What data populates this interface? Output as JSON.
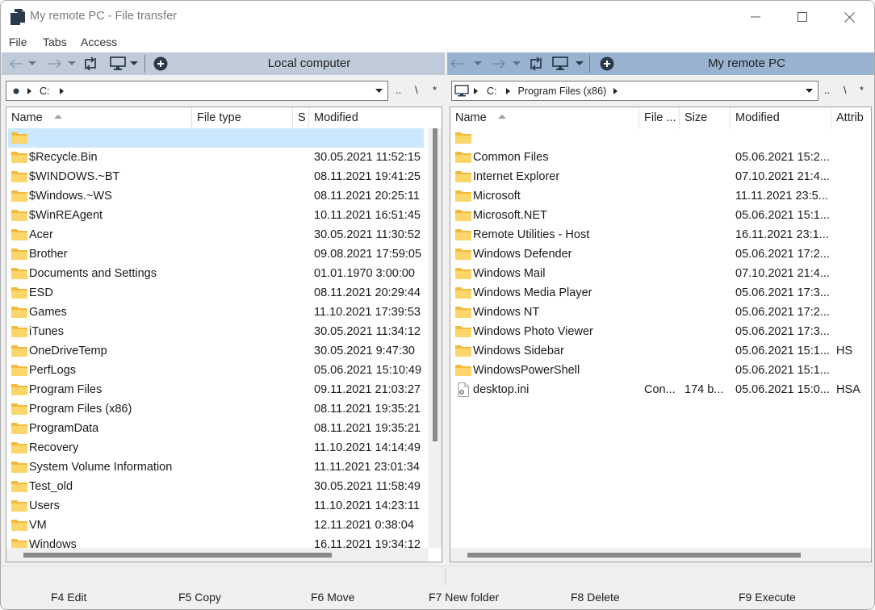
{
  "window": {
    "title": "My remote PC - File transfer",
    "controls": {
      "minimize": "minimize-icon",
      "maximize": "maximize-icon",
      "close": "close-icon"
    }
  },
  "menu": [
    "File",
    "Tabs",
    "Access"
  ],
  "left_panel": {
    "title": "Local computer",
    "toolbar_icons": [
      "back-arrow-icon",
      "chevron-down-icon",
      "forward-arrow-icon",
      "chevron-down-icon",
      "refresh-icon",
      "monitor-icon",
      "chevron-down-icon",
      "add-circle-icon"
    ],
    "address": {
      "root_icon": "dot-icon",
      "segments": [
        "C:"
      ]
    },
    "address_extras": [
      "..",
      "\\",
      "*"
    ],
    "columns": [
      "Name",
      "File type",
      "S",
      "Modified"
    ],
    "sort_column": "Name",
    "rows": [
      {
        "name": "",
        "type": "folder",
        "modified": "",
        "selected": true
      },
      {
        "name": "$Recycle.Bin",
        "type": "folder",
        "modified": "30.05.2021 11:52:15"
      },
      {
        "name": "$WINDOWS.~BT",
        "type": "folder",
        "modified": "08.11.2021 19:41:25"
      },
      {
        "name": "$Windows.~WS",
        "type": "folder",
        "modified": "08.11.2021 20:25:11"
      },
      {
        "name": "$WinREAgent",
        "type": "folder",
        "modified": "10.11.2021 16:51:45"
      },
      {
        "name": "Acer",
        "type": "folder",
        "modified": "30.05.2021 11:30:52"
      },
      {
        "name": "Brother",
        "type": "folder",
        "modified": "09.08.2021 17:59:05"
      },
      {
        "name": "Documents and Settings",
        "type": "folder",
        "modified": "01.01.1970 3:00:00"
      },
      {
        "name": "ESD",
        "type": "folder",
        "modified": "08.11.2021 20:29:44"
      },
      {
        "name": "Games",
        "type": "folder",
        "modified": "11.10.2021 17:39:53"
      },
      {
        "name": "iTunes",
        "type": "folder",
        "modified": "30.05.2021 11:34:12"
      },
      {
        "name": "OneDriveTemp",
        "type": "folder",
        "modified": "30.05.2021 9:47:30"
      },
      {
        "name": "PerfLogs",
        "type": "folder",
        "modified": "05.06.2021 15:10:49"
      },
      {
        "name": "Program Files",
        "type": "folder",
        "modified": "09.11.2021 21:03:27"
      },
      {
        "name": "Program Files (x86)",
        "type": "folder",
        "modified": "08.11.2021 19:35:21"
      },
      {
        "name": "ProgramData",
        "type": "folder",
        "modified": "08.11.2021 19:35:21"
      },
      {
        "name": "Recovery",
        "type": "folder",
        "modified": "11.10.2021 14:14:49"
      },
      {
        "name": "System Volume Information",
        "type": "folder",
        "modified": "11.11.2021 23:01:34"
      },
      {
        "name": "Test_old",
        "type": "folder",
        "modified": "30.05.2021 11:58:49"
      },
      {
        "name": "Users",
        "type": "folder",
        "modified": "11.10.2021 14:23:11"
      },
      {
        "name": "VM",
        "type": "folder",
        "modified": "12.11.2021 0:38:04"
      },
      {
        "name": "Windows",
        "type": "folder",
        "modified": "16.11.2021 19:34:12"
      }
    ],
    "vscroll_position": 0.0,
    "hscroll_position": 0.0
  },
  "right_panel": {
    "title": "My remote PC",
    "toolbar_icons": [
      "back-arrow-icon",
      "chevron-down-icon",
      "forward-arrow-icon",
      "chevron-down-icon",
      "refresh-icon",
      "monitor-icon",
      "chevron-down-icon",
      "add-circle-icon"
    ],
    "address": {
      "root_icon": "computer-icon",
      "segments": [
        "C:",
        "Program Files (x86)"
      ]
    },
    "address_extras": [
      "..",
      "\\",
      "*"
    ],
    "columns": [
      "Name",
      "File ...",
      "Size",
      "Modified",
      "Attrib"
    ],
    "sort_column": "Name",
    "rows": [
      {
        "name": "",
        "type": "folder",
        "filetype": "",
        "size": "",
        "modified": "",
        "attrib": ""
      },
      {
        "name": "Common Files",
        "type": "folder",
        "filetype": "",
        "size": "",
        "modified": "05.06.2021 15:2...",
        "attrib": ""
      },
      {
        "name": "Internet Explorer",
        "type": "folder",
        "filetype": "",
        "size": "",
        "modified": "07.10.2021 21:4...",
        "attrib": ""
      },
      {
        "name": "Microsoft",
        "type": "folder",
        "filetype": "",
        "size": "",
        "modified": "11.11.2021 23:5...",
        "attrib": ""
      },
      {
        "name": "Microsoft.NET",
        "type": "folder",
        "filetype": "",
        "size": "",
        "modified": "05.06.2021 15:1...",
        "attrib": ""
      },
      {
        "name": "Remote Utilities - Host",
        "type": "folder",
        "filetype": "",
        "size": "",
        "modified": "16.11.2021 23:1...",
        "attrib": ""
      },
      {
        "name": "Windows Defender",
        "type": "folder",
        "filetype": "",
        "size": "",
        "modified": "05.06.2021 17:2...",
        "attrib": ""
      },
      {
        "name": "Windows Mail",
        "type": "folder",
        "filetype": "",
        "size": "",
        "modified": "07.10.2021 21:4...",
        "attrib": ""
      },
      {
        "name": "Windows Media Player",
        "type": "folder",
        "filetype": "",
        "size": "",
        "modified": "05.06.2021 17:3...",
        "attrib": ""
      },
      {
        "name": "Windows NT",
        "type": "folder",
        "filetype": "",
        "size": "",
        "modified": "05.06.2021 17:2...",
        "attrib": ""
      },
      {
        "name": "Windows Photo Viewer",
        "type": "folder",
        "filetype": "",
        "size": "",
        "modified": "05.06.2021 17:3...",
        "attrib": ""
      },
      {
        "name": "Windows Sidebar",
        "type": "folder",
        "filetype": "",
        "size": "",
        "modified": "05.06.2021 15:1...",
        "attrib": "HS"
      },
      {
        "name": "WindowsPowerShell",
        "type": "folder",
        "filetype": "",
        "size": "",
        "modified": "05.06.2021 15:1...",
        "attrib": ""
      },
      {
        "name": "desktop.ini",
        "type": "file",
        "filetype": "Con...",
        "size": "174 b...",
        "modified": "05.06.2021 15:0...",
        "attrib": "HSA"
      }
    ],
    "hscroll_position": 0.0
  },
  "bottom_bar": [
    "F4 Edit",
    "F5 Copy",
    "F6 Move",
    "F7 New folder",
    "F8 Delete",
    "F9 Execute"
  ],
  "colors": {
    "left_toolbar_bg": "#bfcbd8",
    "right_toolbar_bg": "#98b2cf",
    "selection": "#cce8ff",
    "folder": "#f8c94a"
  }
}
